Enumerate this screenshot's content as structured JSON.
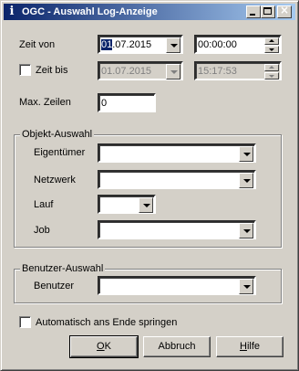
{
  "window": {
    "title": "OGC - Auswahl Log-Anzeige",
    "icon": "info-icon",
    "controls": [
      "minimize-icon",
      "maximize-icon",
      "close-icon"
    ]
  },
  "zeit_von": {
    "label": "Zeit von",
    "date_selected": "01",
    "date_rest": ".07.2015",
    "time": "00:00:00"
  },
  "zeit_bis": {
    "label": "Zeit bis",
    "checked": false,
    "date": "01.07.2015",
    "time": "15:17:53"
  },
  "max_zeilen": {
    "label": "Max. Zeilen",
    "value": "0"
  },
  "objekt_auswahl": {
    "legend": "Objekt-Auswahl",
    "eigentuemer_label": "Eigentümer",
    "netzwerk_label": "Netzwerk",
    "lauf_label": "Lauf",
    "job_label": "Job"
  },
  "benutzer_auswahl": {
    "legend": "Benutzer-Auswahl",
    "benutzer_label": "Benutzer"
  },
  "auto_end": {
    "label": "Automatisch ans Ende springen",
    "checked": false
  },
  "buttons": {
    "ok_underlined": "O",
    "ok_rest": "K",
    "abbruch": "Abbruch",
    "hilfe_underlined": "H",
    "hilfe_rest": "ilfe"
  }
}
